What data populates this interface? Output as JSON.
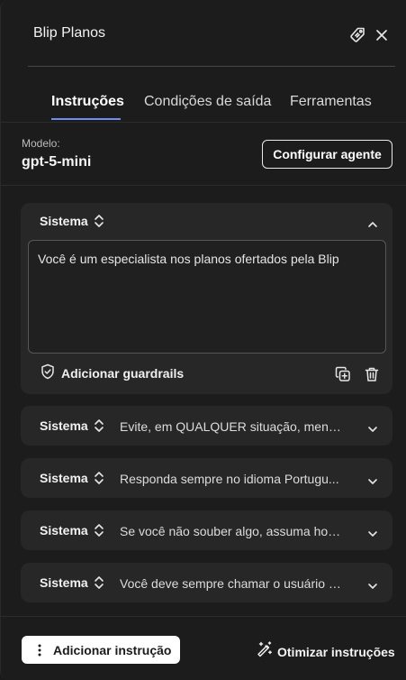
{
  "header": {
    "title": "Blip Planos",
    "tag_icon": "tag-icon",
    "close_icon": "close-icon"
  },
  "tabs": [
    {
      "label": "Instruções",
      "active": true
    },
    {
      "label": "Condições de saída",
      "active": false
    },
    {
      "label": "Ferramentas",
      "active": false
    }
  ],
  "model": {
    "label": "Modelo:",
    "value": "gpt-5-mini",
    "configure_label": "Configurar agente"
  },
  "instructions": [
    {
      "role": "Sistema",
      "text": "Você é um especialista nos planos ofertados pela Blip",
      "expanded": true,
      "guardrails_label": "Adicionar guardrails"
    },
    {
      "role": "Sistema",
      "text": "Evite, em QUALQUER situação, menci...",
      "expanded": false
    },
    {
      "role": "Sistema",
      "text": "Responda sempre no idioma Portugu...",
      "expanded": false
    },
    {
      "role": "Sistema",
      "text": "Se você não souber algo, assuma hon...",
      "expanded": false
    },
    {
      "role": "Sistema",
      "text": "Você deve sempre chamar o usuário p...",
      "expanded": false
    }
  ],
  "footer": {
    "add_label": "Adicionar instrução",
    "optimize_label": "Otimizar instruções"
  },
  "colors": {
    "accent": "#6f8df0",
    "background": "#1c1c1c",
    "card": "#272727"
  }
}
